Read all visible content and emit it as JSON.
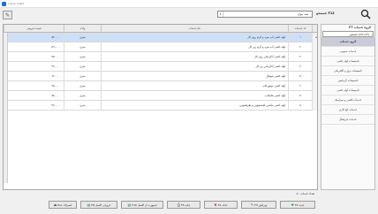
{
  "window": {
    "title": "انتخاب خدمات"
  },
  "toolbar": {
    "search_label": "جستجو F12",
    "combo_value": "همه موارد"
  },
  "categories": {
    "header": "F7 گروه خدمات",
    "search_value": "جستجو (Ctrl+F)",
    "items": [
      "گروه خدمات",
      "خدمات عمومی",
      "تاسیسات لوله کشی",
      "تاسیسات برق و الکتریکی",
      "تاسیسات گرمایش",
      "تاسیسات لوله کشی",
      "خدمات کاشی و سرامیک",
      "خدمات کچ کاری",
      "خدمات غیرفعال"
    ]
  },
  "grid": {
    "columns": {
      "price": "قیمت فروش",
      "unit": "واحد",
      "name": "نام خدمات",
      "code": "کد خدمات"
    },
    "rows": [
      {
        "price": "۸۴۰,۰۰۰",
        "unit": "متری",
        "name": "لوله کشی آب سرد و گرم روی کار",
        "code": "۱"
      },
      {
        "price": "۸۹۰,۰۰۰",
        "unit": "متری",
        "name": "لوله کشی آب سرد و گرم زیر کار",
        "code": "۲"
      },
      {
        "price": "۷۵۰,۰۰۰",
        "unit": "متری",
        "name": "لوله کشی آبگرمکن روی کار",
        "code": "۳"
      },
      {
        "price": "۷۹۰,۰۰۰",
        "unit": "متری",
        "name": "لوله کشی آبگرمکن زیر کار",
        "code": "۴"
      },
      {
        "price": "۹۶۰,۰۰۰",
        "unit": "متری",
        "name": "لوله کشی شوفاژ",
        "code": "۵"
      },
      {
        "price": "۹۵۰,۰۰۰",
        "unit": "متری",
        "name": "لوله کشی موتورخانه",
        "code": "۶"
      },
      {
        "price": "۸۸۰,۰۰۰",
        "unit": "متری",
        "name": "لوله کشی فاضلاب",
        "code": "۷"
      },
      {
        "price": "۷۹۰,۰۰۰",
        "unit": "متری",
        "name": "لوله کشی ماشین لباسشویی و ظرفشویی",
        "code": "۸"
      }
    ]
  },
  "status": {
    "count_text": "تعداد خدمات : ۸"
  },
  "actions": {
    "new": "F2 جدید",
    "edit": "F3 ویرایش",
    "delete": "F4 حذف",
    "print": "F5 چاپ",
    "import": "F10 ایمپورت از اکسل",
    "export": "F8 خروجی اکسل",
    "cancel": "Esc انصراف"
  },
  "colors": {
    "selected_row": "#cfe0f6",
    "selected_category": "#c9ccd8",
    "new_icon": "#2a9a3a",
    "delete_icon": "#d03030"
  },
  "icons": {
    "search": "magnifier-icon",
    "toolbar": "edit-select-icon"
  }
}
